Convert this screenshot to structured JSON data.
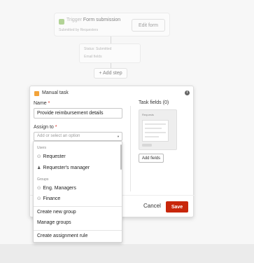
{
  "workflow": {
    "trigger_prefix": "Trigger",
    "trigger_name": "Form submission",
    "trigger_sub": "Submitted by Requesters",
    "edit_form_label": "Edit form",
    "status_line1": "Status: Submitted",
    "status_line2": "Email fields",
    "add_step_label": "+ Add step"
  },
  "modal": {
    "title": "Manual task",
    "name_label": "Name",
    "name_value": "Provide reimbursement details",
    "assign_label": "Assign to",
    "assign_placeholder": "Add or select an option",
    "task_fields_label": "Task fields (0)",
    "preview_label": "Requests",
    "add_fields_label": "Add fields",
    "cancel_label": "Cancel",
    "save_label": "Save",
    "required_mark": "*"
  },
  "dropdown": {
    "users_group": "Users",
    "user_items": [
      "Requester",
      "Requester's manager"
    ],
    "groups_group": "Groups",
    "group_items": [
      "Eng. Managers",
      "Finance"
    ],
    "actions": [
      "Create new group",
      "Manage groups"
    ],
    "footer_action": "Create assignment rule"
  },
  "colors": {
    "save": "#c8260a",
    "required": "#d62c1f",
    "trigger_icon": "#7ab648",
    "task_icon": "#f2a33a"
  }
}
